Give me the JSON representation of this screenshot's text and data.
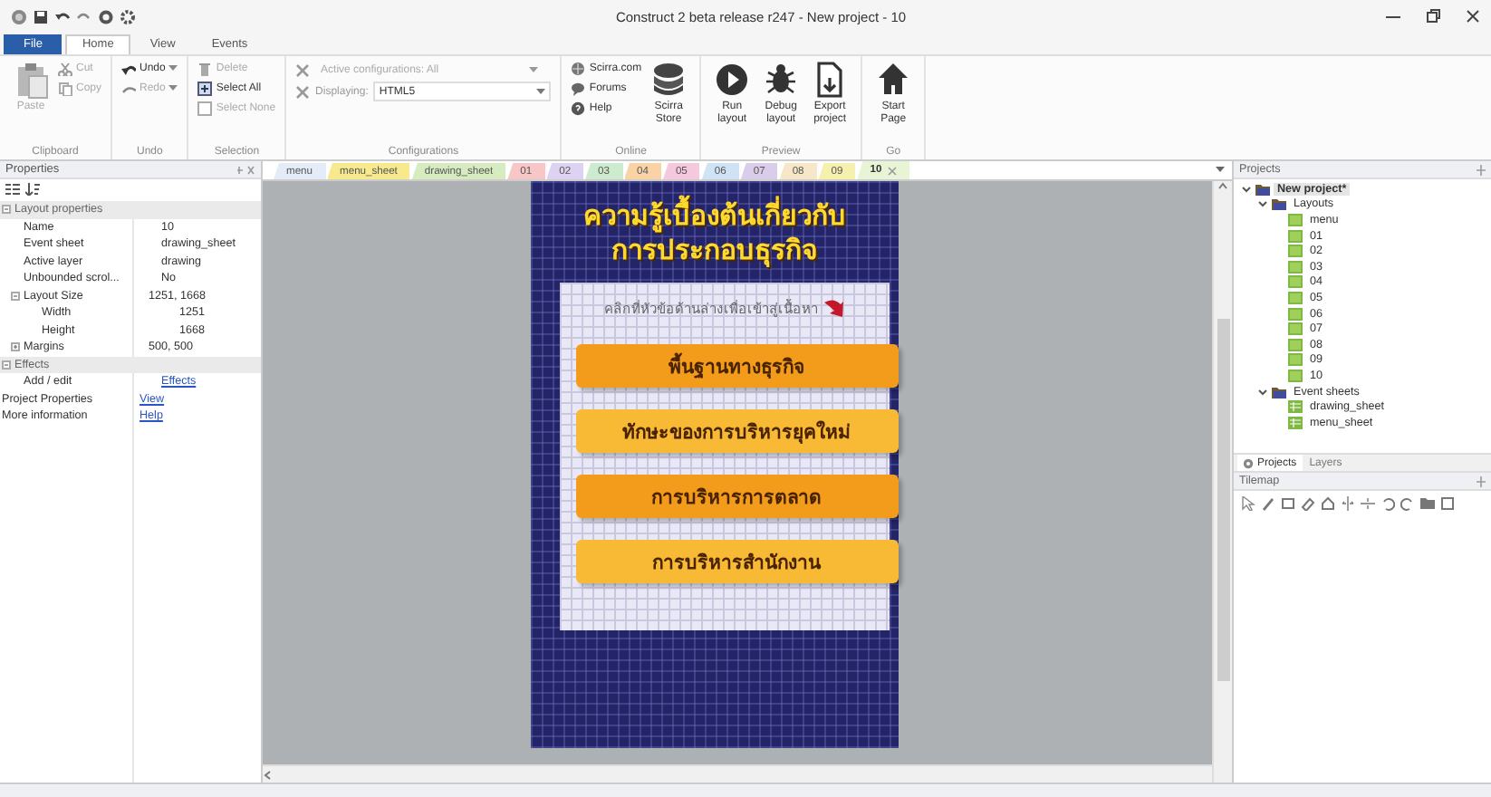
{
  "window": {
    "title": "Construct 2 beta release r247 - New project - 10"
  },
  "ribbon_tabs": [
    {
      "label": "File",
      "kind": "file",
      "selected": false
    },
    {
      "label": "Home",
      "kind": "tab",
      "selected": true
    },
    {
      "label": "View",
      "kind": "tab",
      "selected": false
    },
    {
      "label": "Events",
      "kind": "tab",
      "selected": false
    }
  ],
  "ribbon_groups": [
    {
      "label": "Clipboard",
      "items": [
        {
          "label": "Paste",
          "kind": "large",
          "disabled": true
        },
        {
          "label": "Cut",
          "kind": "small",
          "disabled": true
        },
        {
          "label": "Copy",
          "kind": "small",
          "disabled": true
        }
      ]
    },
    {
      "label": "Undo",
      "items": [
        {
          "label": "Undo",
          "kind": "menu",
          "disabled": false
        },
        {
          "label": "Redo",
          "kind": "menu",
          "disabled": true
        }
      ]
    },
    {
      "label": "Selection",
      "items": [
        {
          "label": "Delete",
          "kind": "small",
          "disabled": true
        },
        {
          "label": "Select All",
          "kind": "small",
          "disabled": false
        },
        {
          "label": "Select None",
          "kind": "small",
          "disabled": true
        }
      ]
    },
    {
      "label": "Configurations",
      "items": [
        {
          "label": "Active configurations: All",
          "kind": "dropdown",
          "disabled": true
        },
        {
          "label": "Displaying:",
          "value": "HTML5",
          "kind": "dropdown",
          "disabled": false
        }
      ]
    },
    {
      "label": "Online",
      "items": [
        {
          "label": "Scirra.com",
          "kind": "small",
          "disabled": false
        },
        {
          "label": "Forums",
          "kind": "small",
          "disabled": false
        },
        {
          "label": "Help",
          "kind": "small",
          "disabled": false
        },
        {
          "label": "Scirra Store",
          "kind": "large",
          "disabled": false
        }
      ]
    },
    {
      "label": "Preview",
      "items": [
        {
          "label": "Run layout",
          "kind": "large",
          "disabled": false
        },
        {
          "label": "Debug layout",
          "kind": "large",
          "disabled": false
        },
        {
          "label": "Export project",
          "kind": "large",
          "disabled": false
        }
      ]
    },
    {
      "label": "Go",
      "items": [
        {
          "label": "Start Page",
          "kind": "large",
          "disabled": false
        }
      ]
    }
  ],
  "properties": {
    "title": "Properties",
    "rows": [
      {
        "kind": "section",
        "name": "Layout properties",
        "expanded": true,
        "children": [
          {
            "kind": "prop",
            "name": "Name",
            "value": "10"
          },
          {
            "kind": "prop",
            "name": "Event sheet",
            "value": "drawing_sheet"
          },
          {
            "kind": "prop",
            "name": "Active layer",
            "value": "drawing"
          },
          {
            "kind": "prop",
            "name": "Unbounded scrol...",
            "value": "No"
          },
          {
            "kind": "group",
            "name": "Layout Size",
            "value": "1251, 1668",
            "expanded": true,
            "children": [
              {
                "kind": "prop",
                "name": "Width",
                "value": "1251"
              },
              {
                "kind": "prop",
                "name": "Height",
                "value": "1668"
              }
            ]
          },
          {
            "kind": "group",
            "name": "Margins",
            "value": "500, 500",
            "expanded": false
          }
        ]
      },
      {
        "kind": "section",
        "name": "Effects",
        "expanded": true,
        "children": [
          {
            "kind": "prop",
            "name": "Add / edit",
            "value": "Effects",
            "link": true
          }
        ]
      },
      {
        "kind": "prop",
        "name": "Project Properties",
        "value": "View",
        "link": true
      },
      {
        "kind": "prop",
        "name": "More information",
        "value": "Help",
        "link": true
      }
    ]
  },
  "editor_tabs": [
    {
      "label": "menu",
      "color": "#e4ecf7",
      "selected": false
    },
    {
      "label": "menu_sheet",
      "color": "#f7e98e",
      "selected": false
    },
    {
      "label": "drawing_sheet",
      "color": "#d6ecc0",
      "selected": false
    },
    {
      "label": "01",
      "color": "#f7c6c6",
      "selected": false
    },
    {
      "label": "02",
      "color": "#ddd2f2",
      "selected": false
    },
    {
      "label": "03",
      "color": "#cdeccf",
      "selected": false
    },
    {
      "label": "04",
      "color": "#f9d3a6",
      "selected": false
    },
    {
      "label": "05",
      "color": "#f5c8dd",
      "selected": false
    },
    {
      "label": "06",
      "color": "#cfe3f4",
      "selected": false
    },
    {
      "label": "07",
      "color": "#dacde9",
      "selected": false
    },
    {
      "label": "08",
      "color": "#f6e7c9",
      "selected": false
    },
    {
      "label": "09",
      "color": "#f6f0ae",
      "selected": false
    },
    {
      "label": "10",
      "color": "#e7f5d6",
      "selected": true
    }
  ],
  "layout": {
    "title_lines": [
      "ความรู้เบื้องต้นเกี่ยวกับ",
      "การประกอบธุรกิจ"
    ],
    "instruction": "คลิกที่หัวข้อด้านล่างเพื่อเข้าสู่เนื้อหา",
    "buttons": [
      {
        "label": "พื้นฐานทางธุรกิจ",
        "color": "#f39c1c"
      },
      {
        "label": "ทักษะของการบริหารยุคใหม่",
        "color": "#f8b934"
      },
      {
        "label": "การบริหารการตลาด",
        "color": "#f39c1c"
      },
      {
        "label": "การบริหารสำนักงาน",
        "color": "#f8b934"
      }
    ]
  },
  "projects": {
    "title": "Projects",
    "tree": [
      {
        "label": "New project*",
        "kind": "project",
        "selected": true,
        "expanded": true,
        "children": [
          {
            "label": "Layouts",
            "kind": "folder",
            "selected": false,
            "expanded": true,
            "children": [
              {
                "label": "menu",
                "kind": "layout",
                "selected": false
              },
              {
                "label": "01",
                "kind": "layout",
                "selected": false
              },
              {
                "label": "02",
                "kind": "layout",
                "selected": false
              },
              {
                "label": "03",
                "kind": "layout",
                "selected": false
              },
              {
                "label": "04",
                "kind": "layout",
                "selected": false
              },
              {
                "label": "05",
                "kind": "layout",
                "selected": false
              },
              {
                "label": "06",
                "kind": "layout",
                "selected": false
              },
              {
                "label": "07",
                "kind": "layout",
                "selected": false
              },
              {
                "label": "08",
                "kind": "layout",
                "selected": false
              },
              {
                "label": "09",
                "kind": "layout",
                "selected": false
              },
              {
                "label": "10",
                "kind": "layout",
                "selected": false
              }
            ]
          },
          {
            "label": "Event sheets",
            "kind": "folder",
            "selected": false,
            "expanded": true,
            "children": [
              {
                "label": "drawing_sheet",
                "kind": "sheet",
                "selected": false
              },
              {
                "label": "menu_sheet",
                "kind": "sheet",
                "selected": false
              }
            ]
          }
        ]
      }
    ],
    "tabs": [
      {
        "label": "Projects",
        "selected": true
      },
      {
        "label": "Layers",
        "selected": false
      }
    ]
  },
  "tilemap": {
    "title": "Tilemap"
  }
}
